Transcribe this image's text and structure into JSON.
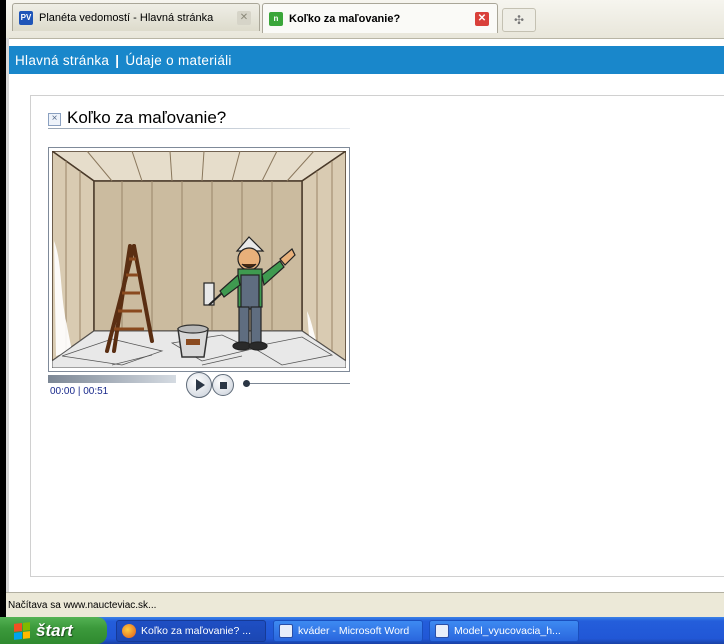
{
  "browser": {
    "tabs": [
      {
        "favicon": "PV",
        "label": "Planéta vedomostí - Hlavná stránka",
        "active": false
      },
      {
        "favicon": "n",
        "label": "Koľko za maľovanie?",
        "active": true
      }
    ],
    "new_tab_icon": "plus-icon"
  },
  "site_nav": {
    "home": "Hlavná stránka",
    "separator": "|",
    "material_info": "Údaje o materiáli"
  },
  "material": {
    "title": "Koľko za maľovanie?",
    "title_icon": "close-x-icon"
  },
  "player": {
    "current_time": "00:00",
    "separator": "|",
    "duration": "00:51",
    "progress": 0
  },
  "status_bar": {
    "text": "Načítava sa www.naucteviac.sk..."
  },
  "taskbar": {
    "start_label": "štart",
    "items": [
      {
        "label": "Koľko za maľovanie? ...",
        "icon": "firefox-icon"
      },
      {
        "label": "kváder - Microsoft Word",
        "icon": "word-icon"
      },
      {
        "label": "Model_vyucovacia_h...",
        "icon": "word-icon"
      }
    ]
  },
  "colors": {
    "site_nav_bg": "#1987cb",
    "taskbar_bg": "#245edb",
    "start_green": "#3c9a3c"
  }
}
